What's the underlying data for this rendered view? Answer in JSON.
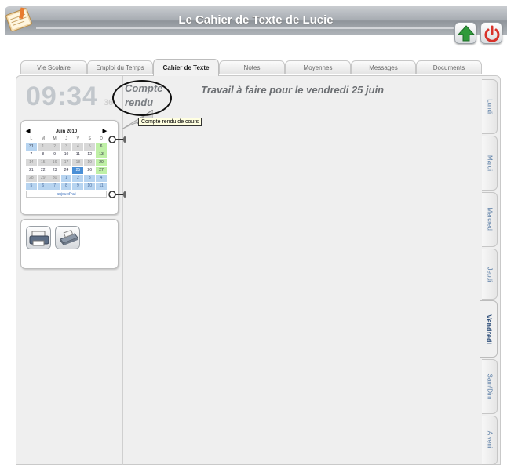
{
  "app": {
    "title": "Le Cahier de Texte de Lucie"
  },
  "icons": {
    "logo": "notebook-pencil-icon",
    "home": "green-up-arrow-icon",
    "power": "red-power-icon",
    "print": "printer-icon",
    "scanner": "scanner-icon"
  },
  "colors": {
    "accent": "#4a8fd6",
    "weekend": "#bff0a6",
    "tab_text": "#5b7ea6"
  },
  "tabs": [
    {
      "label": "Vie Scolaire"
    },
    {
      "label": "Emploi du Temps"
    },
    {
      "label": "Cahier de Texte",
      "active": true
    },
    {
      "label": "Notes"
    },
    {
      "label": "Moyennes"
    },
    {
      "label": "Messages"
    },
    {
      "label": "Documents"
    }
  ],
  "clock": {
    "time": "09:34",
    "seconds": "36"
  },
  "curl": {
    "label": "Compte rendu",
    "tooltip": "Compte rendu de cours"
  },
  "main": {
    "header": "Travail à faire pour le vendredi 25 juin"
  },
  "calendar": {
    "month": "Juin 2010",
    "days_of_week": [
      "L",
      "M",
      "M",
      "J",
      "V",
      "S",
      "D"
    ],
    "today_label": "aujourd'hui",
    "weeks": [
      [
        "31",
        "1",
        "2",
        "3",
        "4",
        "5",
        "6"
      ],
      [
        "7",
        "8",
        "9",
        "10",
        "11",
        "12",
        "13"
      ],
      [
        "14",
        "15",
        "16",
        "17",
        "18",
        "19",
        "20"
      ],
      [
        "21",
        "22",
        "23",
        "24",
        "25",
        "26",
        "27"
      ],
      [
        "28",
        "29",
        "30",
        "1",
        "2",
        "3",
        "4"
      ],
      [
        "5",
        "6",
        "7",
        "8",
        "9",
        "10",
        "11"
      ]
    ]
  },
  "day_tabs": [
    {
      "label": "Lundi"
    },
    {
      "label": "Mardi"
    },
    {
      "label": "Mercredi"
    },
    {
      "label": "Jeudi"
    },
    {
      "label": "Vendredi",
      "active": true
    },
    {
      "label": "Sam/Dim"
    },
    {
      "label": "A venir"
    }
  ]
}
